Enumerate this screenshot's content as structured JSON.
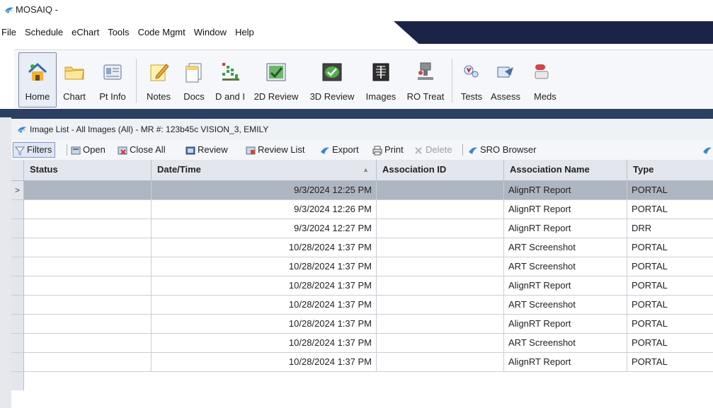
{
  "app": {
    "title": "MOSAIQ -",
    "menu": [
      "File",
      "Schedule",
      "eChart",
      "Tools",
      "Code Mgmt",
      "Window",
      "Help"
    ]
  },
  "toolbar": {
    "buttons": [
      {
        "label": "Home",
        "icon": "home-icon"
      },
      {
        "label": "Chart",
        "icon": "folder-icon"
      },
      {
        "label": "Pt Info",
        "icon": "id-card-icon"
      },
      {
        "label": "Notes",
        "icon": "notepad-icon"
      },
      {
        "label": "Docs",
        "icon": "documents-icon"
      },
      {
        "label": "D and I",
        "icon": "diagnosis-icon"
      },
      {
        "label": "2D Review",
        "icon": "review-2d-icon"
      },
      {
        "label": "3D Review",
        "icon": "review-3d-icon"
      },
      {
        "label": "Images",
        "icon": "xray-icon"
      },
      {
        "label": "RO Treat",
        "icon": "treatment-icon"
      },
      {
        "label": "Tests",
        "icon": "tests-icon"
      },
      {
        "label": "Assess",
        "icon": "assess-icon"
      },
      {
        "label": "Meds",
        "icon": "meds-icon"
      }
    ]
  },
  "window": {
    "title": "Image List - All Images (All) - MR #: 123b45c   VISION_3, EMILY"
  },
  "grid_toolbar": {
    "filters": "Filters",
    "open": "Open",
    "close_all": "Close All",
    "review": "Review",
    "review_list": "Review List",
    "export": "Export",
    "print": "Print",
    "delete": "Delete",
    "sro_browser": "SRO Browser"
  },
  "table": {
    "columns": [
      "Status",
      "Date/Time",
      "Association ID",
      "Association Name",
      "Type"
    ],
    "selected_indicator": ">",
    "rows": [
      {
        "status": "",
        "datetime": "9/3/2024 12:25 PM",
        "assoc_id": "",
        "assoc_name": "AlignRT Report",
        "type": "PORTAL"
      },
      {
        "status": "",
        "datetime": "9/3/2024 12:26 PM",
        "assoc_id": "",
        "assoc_name": "AlignRT Report",
        "type": "PORTAL"
      },
      {
        "status": "",
        "datetime": "9/3/2024 12:27 PM",
        "assoc_id": "",
        "assoc_name": "AlignRT Report",
        "type": "DRR"
      },
      {
        "status": "",
        "datetime": "10/28/2024 1:37 PM",
        "assoc_id": "",
        "assoc_name": "ART Screenshot",
        "type": "PORTAL"
      },
      {
        "status": "",
        "datetime": "10/28/2024 1:37 PM",
        "assoc_id": "",
        "assoc_name": "ART Screenshot",
        "type": "PORTAL"
      },
      {
        "status": "",
        "datetime": "10/28/2024 1:37 PM",
        "assoc_id": "",
        "assoc_name": "AlignRT Report",
        "type": "PORTAL"
      },
      {
        "status": "",
        "datetime": "10/28/2024 1:37 PM",
        "assoc_id": "",
        "assoc_name": "ART Screenshot",
        "type": "PORTAL"
      },
      {
        "status": "",
        "datetime": "10/28/2024 1:37 PM",
        "assoc_id": "",
        "assoc_name": "AlignRT Report",
        "type": "PORTAL"
      },
      {
        "status": "",
        "datetime": "10/28/2024 1:37 PM",
        "assoc_id": "",
        "assoc_name": "ART Screenshot",
        "type": "PORTAL"
      },
      {
        "status": "",
        "datetime": "10/28/2024 1:37 PM",
        "assoc_id": "",
        "assoc_name": "AlignRT Report",
        "type": "PORTAL"
      }
    ]
  },
  "colors": {
    "title_accent": "#1b2447",
    "selected_row": "#aeb6c2",
    "inner_titlebar": "#2b3f63"
  }
}
